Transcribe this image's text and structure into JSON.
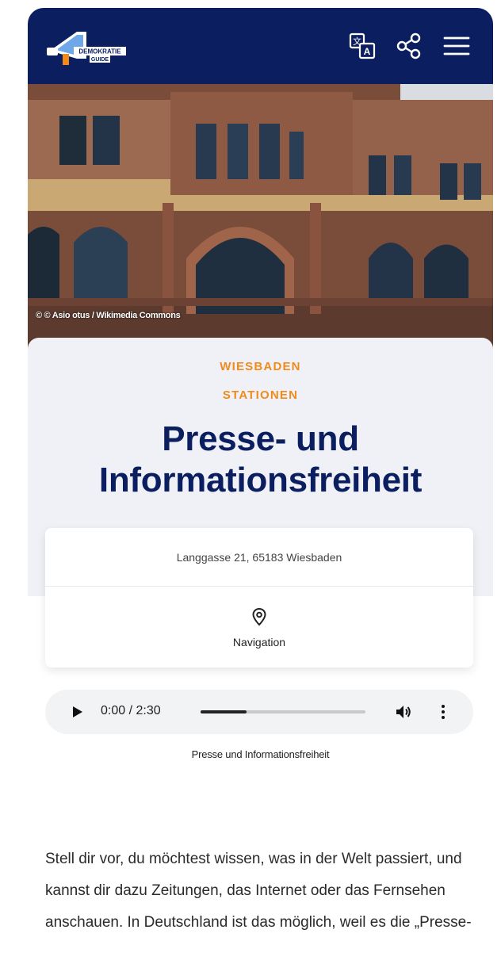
{
  "header": {
    "logo_line1": "DEMOKRATIE",
    "logo_line2": "GUIDE",
    "icons": [
      "translate-icon",
      "share-icon",
      "menu-icon"
    ],
    "bg_color": "#0b1f60"
  },
  "hero": {
    "credit": "© © Asio otus / Wikimedia Commons"
  },
  "station": {
    "city": "WIESBADEN",
    "category": "STATIONEN",
    "title": "Presse- und Informationsfreiheit",
    "accent_color": "#f28a1a",
    "title_color": "#0b1f60"
  },
  "location": {
    "address": "Langgasse 21, 65183 Wiesbaden",
    "navigation_label": "Navigation"
  },
  "audio": {
    "time": "0:00 / 2:30",
    "progress_fraction": 0.28,
    "caption": "Presse und Informationsfreiheit"
  },
  "content": {
    "paragraph": "Stell dir vor, du möchtest wissen, was in der Welt passiert, und kannst dir dazu Zeitungen, das Internet oder das Fernsehen anschauen. In Deutschland ist das möglich, weil es die „Presse-"
  }
}
